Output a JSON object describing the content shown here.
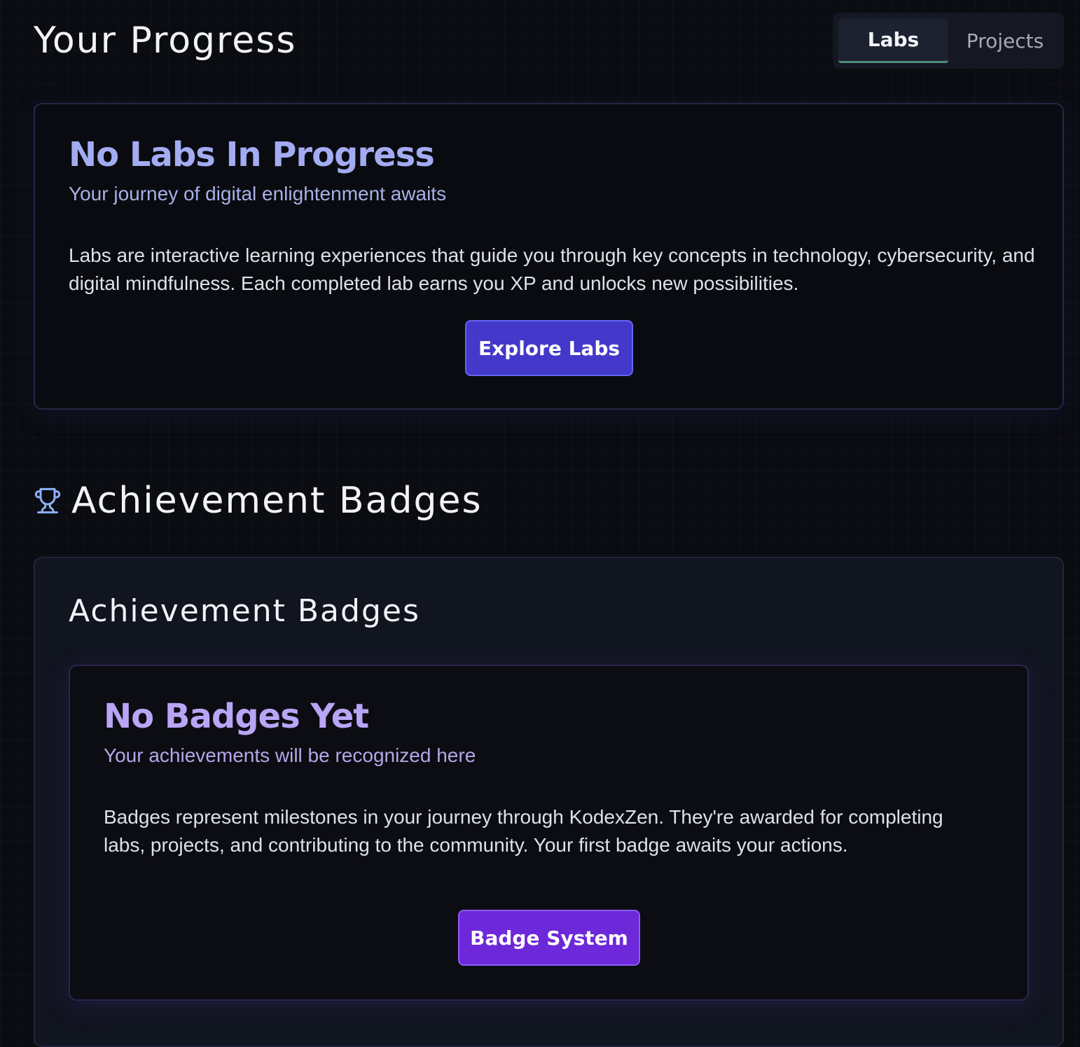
{
  "header": {
    "title": "Your Progress"
  },
  "tabs": [
    {
      "label": "Labs",
      "active": true
    },
    {
      "label": "Projects",
      "active": false
    }
  ],
  "labs_empty": {
    "title": "No Labs In Progress",
    "subtitle": "Your journey of digital enlightenment awaits",
    "description": "Labs are interactive learning experiences that guide you through key concepts in technology, cybersecurity, and digital mindfulness. Each completed lab earns you XP and unlocks new possibilities.",
    "button_label": "Explore Labs"
  },
  "achievements": {
    "section_title": "Achievement Badges",
    "section_icon": "trophy-icon",
    "panel_title": "Achievement Badges",
    "empty": {
      "title": "No Badges Yet",
      "subtitle": "Your achievements will be recognized here",
      "description": "Badges represent milestones in your journey through KodexZen. They're awarded for completing labs, projects, and contributing to the community. Your first badge awaits your actions.",
      "button_label": "Badge System"
    }
  },
  "colors": {
    "background": "#0b0c12",
    "labs_accent": "#a3acf2",
    "badges_accent": "#b9a5f5",
    "explore_button": "#4338ca",
    "badge_button": "#6d28d9",
    "active_tab_underline": "#4d8f78"
  }
}
